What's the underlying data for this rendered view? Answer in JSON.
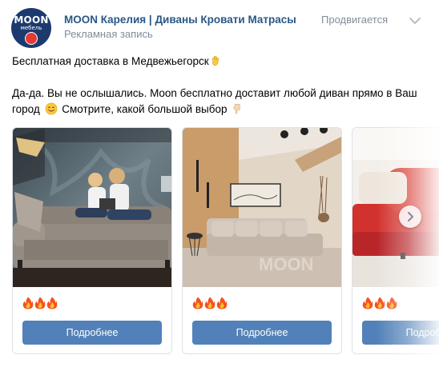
{
  "header": {
    "avatar_logo_text": "MOON",
    "avatar_logo_sub": "мебель",
    "group_name": "MOON Карелия | Диваны Кровати Матрасы",
    "post_type": "Рекламная запись",
    "promoted": "Продвигается"
  },
  "post": {
    "line1": "Бесплатная доставка в Медвежьегорск",
    "line2": "Да-да. Вы не ослышались. Moon бесплатно доставит любой диван прямо в Ваш",
    "line3_a": "город",
    "line3_b": "Смотрите, какой большой выбор"
  },
  "carousel": {
    "cards": [
      {
        "fires": "🔥🔥🔥",
        "button_label": "Подробнее",
        "watermark": ""
      },
      {
        "fires": "🔥🔥🔥",
        "button_label": "Подробнее",
        "watermark": "MOON"
      },
      {
        "fires": "🔥🔥🔥",
        "button_label": "Подробнее",
        "watermark": ""
      }
    ]
  },
  "colors": {
    "link": "#2a5885",
    "meta": "#818c99",
    "button": "#5181b8",
    "brand_navy": "#1d3a6e"
  },
  "icons": [
    "waving-hand-icon",
    "smile-icon",
    "pointing-down-hand-icon",
    "fire-icon",
    "chevron-down-icon",
    "chevron-right-icon"
  ]
}
